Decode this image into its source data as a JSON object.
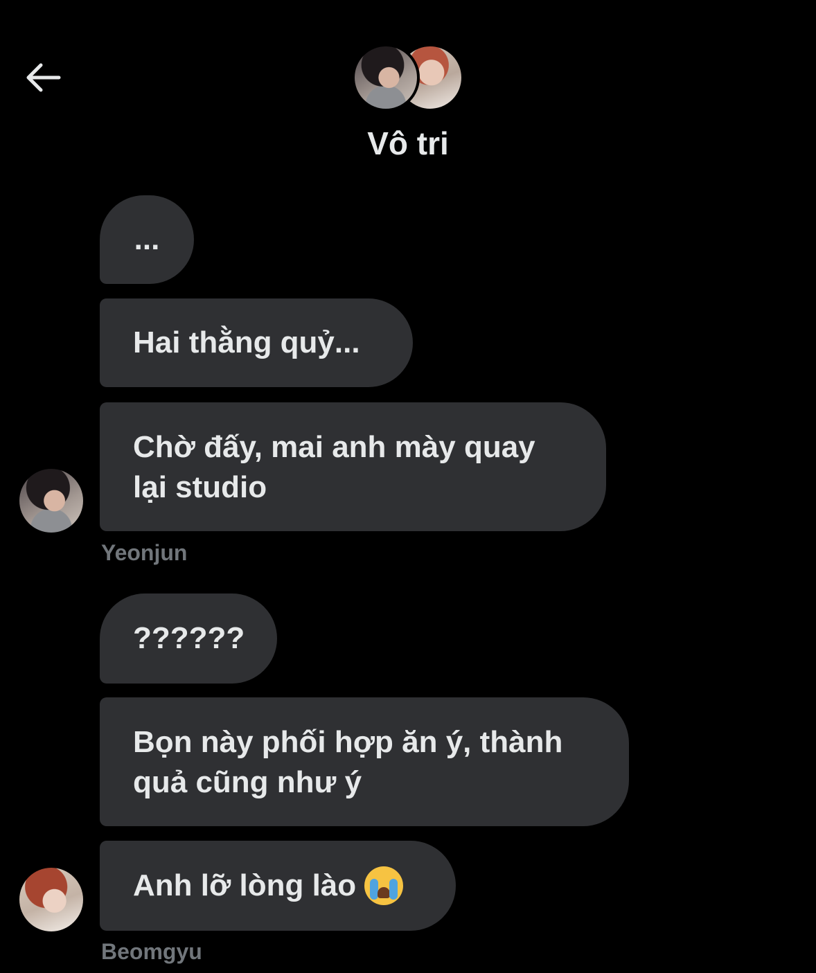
{
  "header": {
    "back_icon": "arrow-left-icon",
    "title": "Vô tri"
  },
  "messages": [
    {
      "text": "..."
    },
    {
      "text": "Hai thằng quỷ..."
    },
    {
      "text": "Chờ đấy, mai anh mày quay lại studio"
    },
    {
      "text": "??????"
    },
    {
      "text": "Bọn này phối hợp ăn ý, thành quả cũng như ý"
    },
    {
      "text": "Anh lỡ lòng lào",
      "emoji": "loudly-crying-face-icon"
    }
  ],
  "senders": {
    "first": "Yeonjun",
    "second": "Beomgyu"
  },
  "colors": {
    "background": "#000000",
    "bubble": "#2f3033",
    "text": "#e7e9ea",
    "meta": "#71767b"
  }
}
